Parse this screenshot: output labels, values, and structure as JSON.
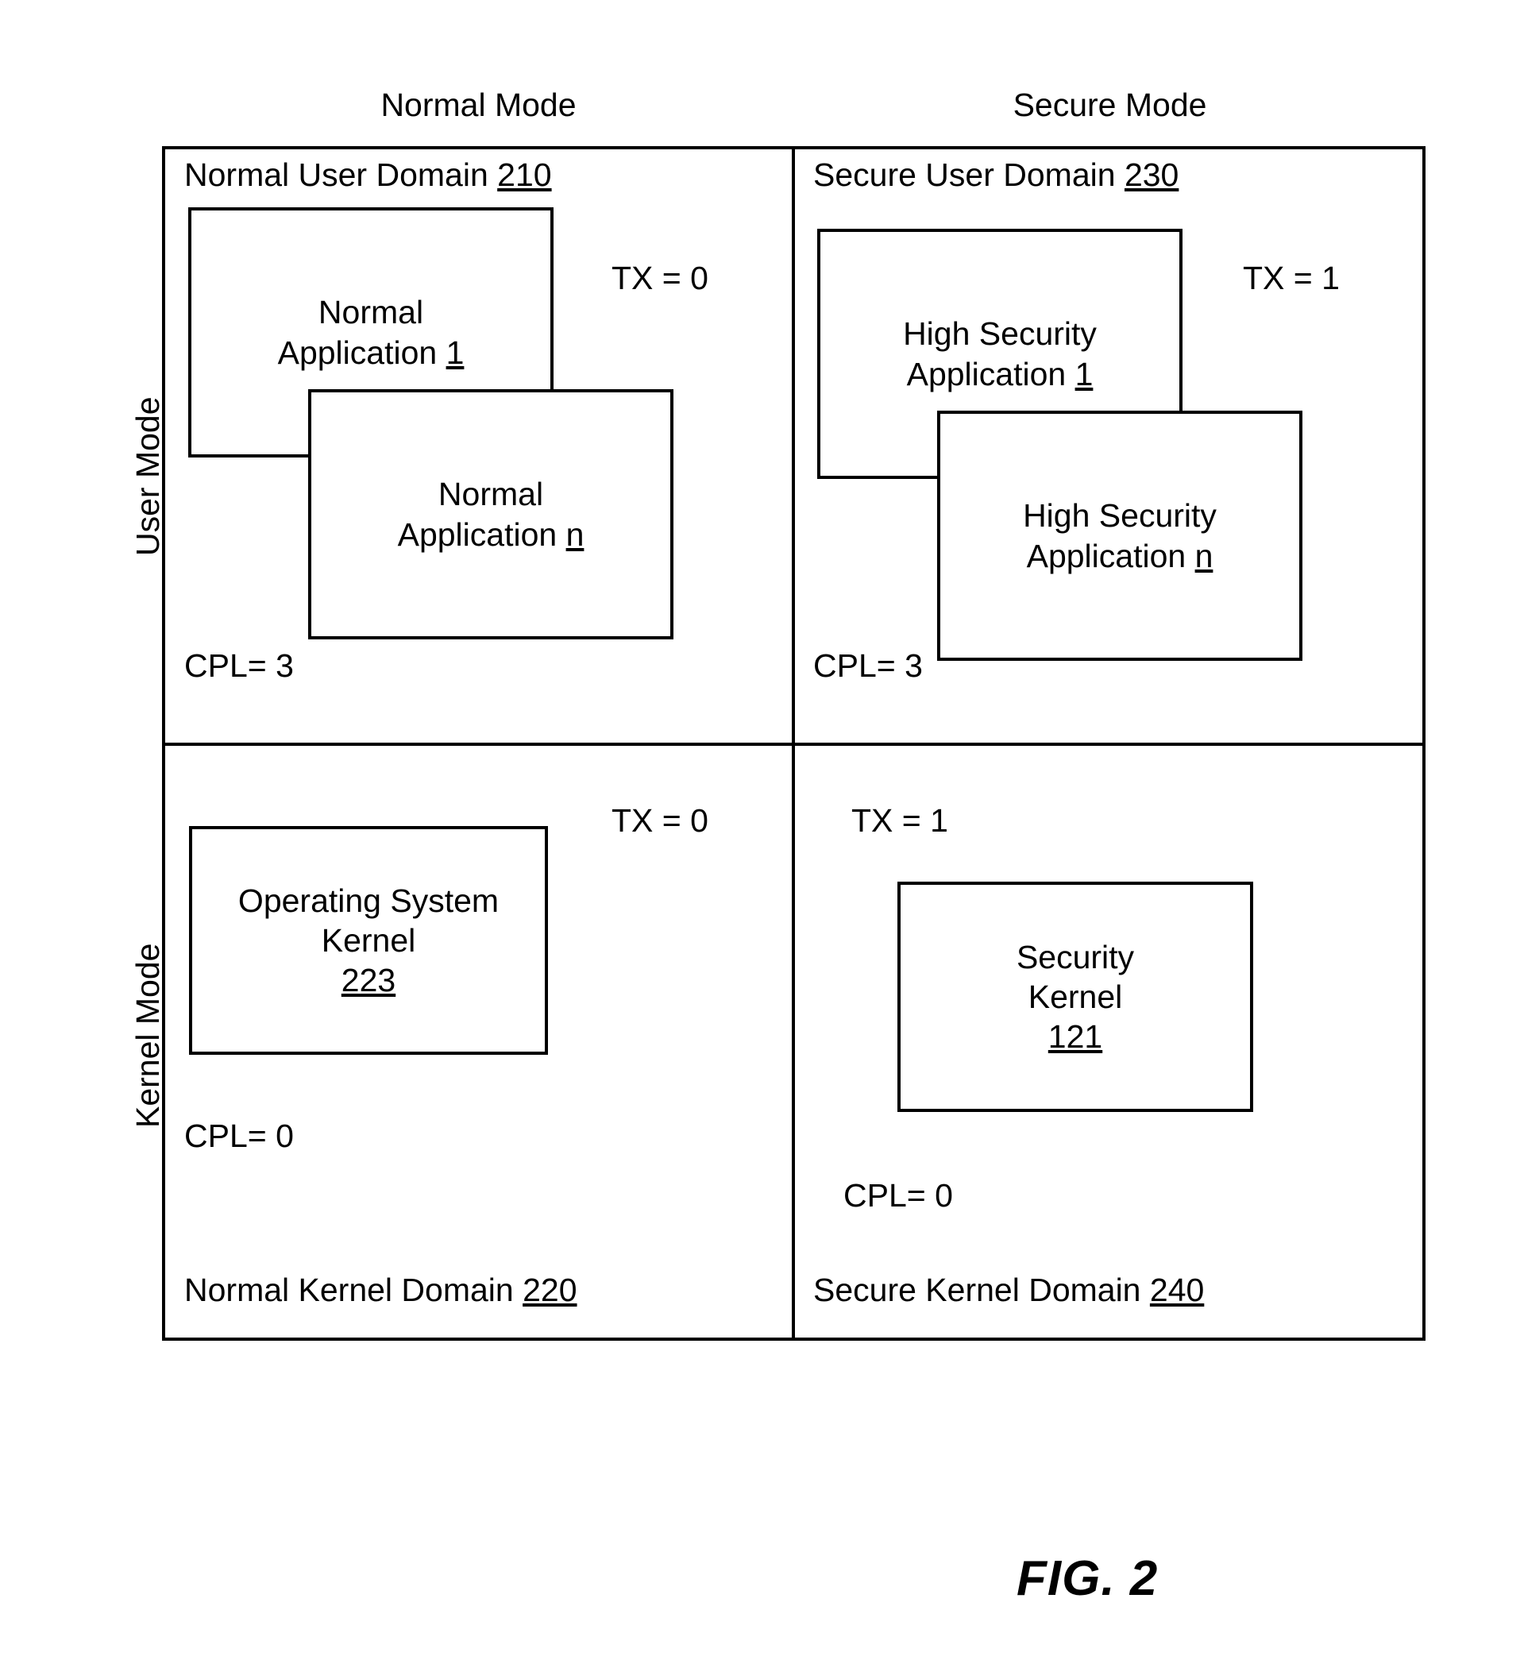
{
  "figure": {
    "caption": "FIG. 2",
    "column_headers": {
      "left": "Normal Mode",
      "right": "Secure Mode"
    },
    "row_labels": {
      "top": "User Mode",
      "bottom": "Kernel Mode"
    }
  },
  "quadrants": {
    "normal_user_domain": {
      "title": "Normal User Domain",
      "ref": "210",
      "tx": "TX = 0",
      "cpl": "CPL= 3",
      "boxes": [
        {
          "line1": "Normal",
          "line2": "Application",
          "ref": "1"
        },
        {
          "line1": "Normal",
          "line2": "Application",
          "ref": "n"
        }
      ]
    },
    "secure_user_domain": {
      "title": "Secure User Domain",
      "ref": "230",
      "tx": "TX = 1",
      "cpl": "CPL= 3",
      "boxes": [
        {
          "line1": "High Security",
          "line2": "Application",
          "ref": "1"
        },
        {
          "line1": "High Security",
          "line2": "Application",
          "ref": "n"
        }
      ]
    },
    "normal_kernel_domain": {
      "title": "Normal Kernel Domain",
      "ref": "220",
      "tx": "TX = 0",
      "cpl": "CPL= 0",
      "boxes": [
        {
          "line1": "Operating System",
          "line2": "Kernel",
          "ref": "223"
        }
      ]
    },
    "secure_kernel_domain": {
      "title": "Secure Kernel Domain",
      "ref": "240",
      "tx": "TX = 1",
      "cpl": "CPL= 0",
      "boxes": [
        {
          "line1": "Security",
          "line2": "Kernel",
          "ref": "121"
        }
      ]
    }
  },
  "colors": {
    "ink": "#000000",
    "paper": "#ffffff"
  }
}
